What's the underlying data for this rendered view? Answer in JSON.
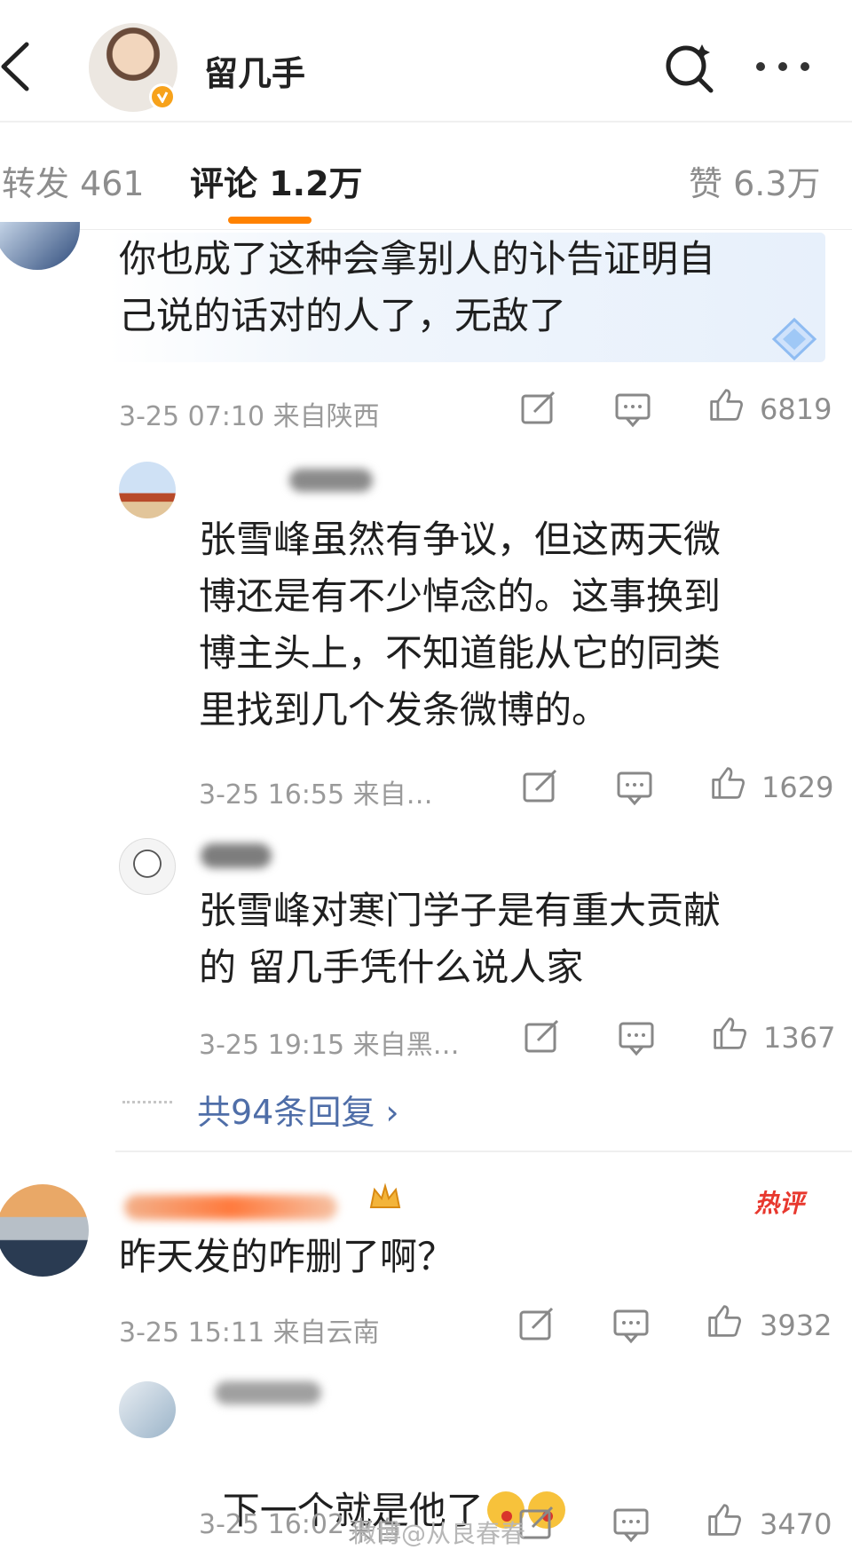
{
  "header": {
    "title": "留几手",
    "icons": [
      "back-arrow-icon",
      "search-icon",
      "more-icon",
      "verified-badge-icon"
    ]
  },
  "tabs": [
    {
      "label": "转发 461"
    },
    {
      "label": "评论 1.2万",
      "active": true
    },
    {
      "label": "赞 6.3万"
    }
  ],
  "comments": [
    {
      "text": "你也成了这种会拿别人的讣告证明自己说的话对的人了，无敌了",
      "line1": "你也成了这种会拿别人的讣告证明自",
      "line2": "己说的话对的人了，无敌了",
      "meta": "3-25 07:10  来自陕西",
      "likes": "6819",
      "replies": [
        {
          "line1": "张雪峰虽然有争议，但这两天微",
          "line2": "博还是有不少悼念的。这事换到",
          "line3": "博主头上，不知道能从它的同类",
          "line4": "里找到几个发条微博的。",
          "meta": "3-25 16:55  来自…",
          "likes": "1629"
        },
        {
          "line1": "张雪峰对寒门学子是有重大贡献",
          "line2": "的 留几手凭什么说人家",
          "meta": "3-25 19:15  来自黑…",
          "likes": "1367"
        }
      ],
      "replies_link": "共94条回复 ›"
    },
    {
      "badge": "热评",
      "text": "昨天发的咋删了啊？",
      "meta": "3-25 15:11  来自云南",
      "likes": "3932",
      "replies": [
        {
          "text": "下一个就是他了",
          "meta": "3-25 16:02",
          "meta_tail": "来自",
          "likes": "3470"
        }
      ]
    }
  ],
  "watermark": "微博@从良春春",
  "colors": {
    "accent": "#ff8200",
    "link": "#4f6ea8",
    "hot": "#e8382e",
    "meta": "#9a9a9a"
  }
}
